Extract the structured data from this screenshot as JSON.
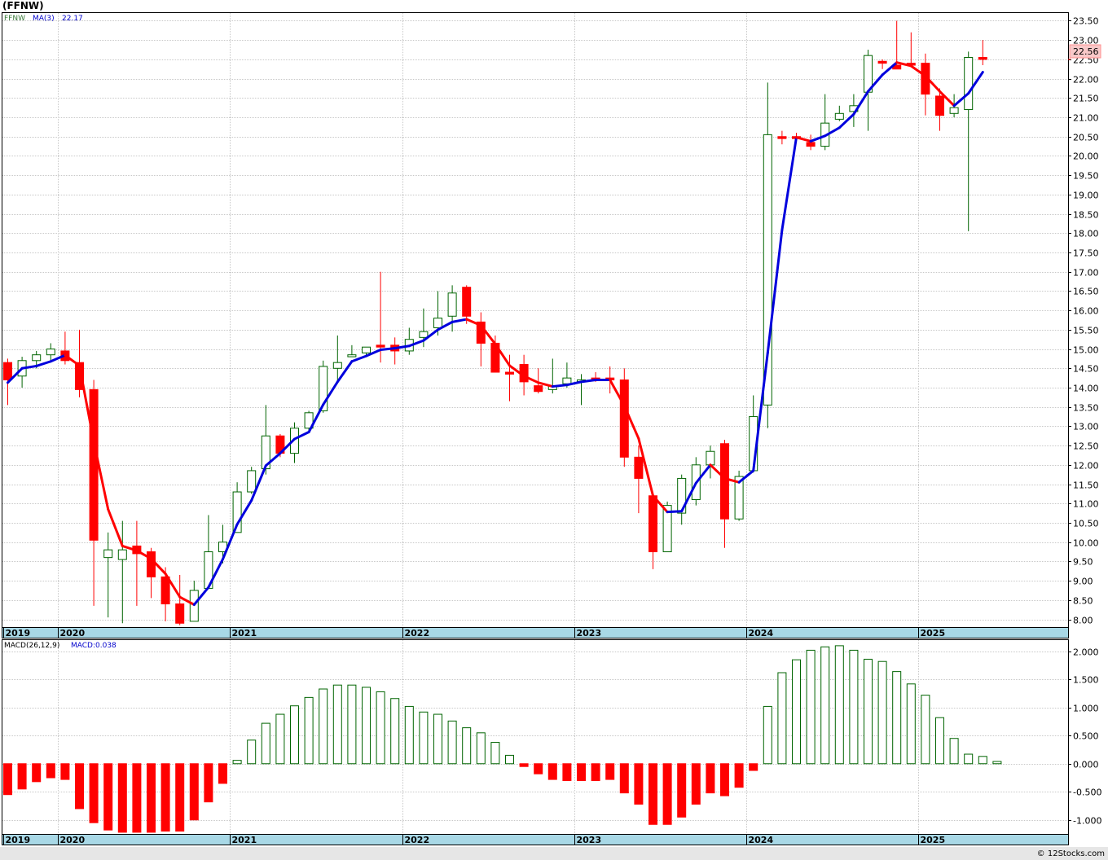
{
  "title": "(FFNW)",
  "footer": "© 12Stocks.com",
  "colors": {
    "up": "#006400",
    "down": "#ff0000",
    "ma_up": "#0000dd",
    "ma_down": "#ff0000",
    "axis_band": "#a8d8e6",
    "grid": "#c8c8c8"
  },
  "chart_data": [
    {
      "type": "candlestick",
      "ticker": "FFNW",
      "legend": {
        "symbol": "FFNW",
        "ma_label": "MA(3)",
        "ma_value": "22.17"
      },
      "last_price_label": "22.56",
      "ylim": [
        7.8,
        23.7
      ],
      "y_ticks": [
        "8.00",
        "8.50",
        "9.00",
        "9.50",
        "10.00",
        "10.50",
        "11.00",
        "11.50",
        "12.00",
        "12.50",
        "13.00",
        "13.50",
        "14.00",
        "14.50",
        "15.00",
        "15.50",
        "16.00",
        "16.50",
        "17.00",
        "17.50",
        "18.00",
        "18.50",
        "19.00",
        "19.50",
        "20.00",
        "20.50",
        "21.00",
        "21.50",
        "22.00",
        "22.50",
        "23.00",
        "23.50"
      ],
      "x_labels": [
        {
          "label": "2019",
          "i": -0.3
        },
        {
          "label": "2020",
          "i": 3.5
        },
        {
          "label": "2021",
          "i": 15.5
        },
        {
          "label": "2022",
          "i": 27.5
        },
        {
          "label": "2023",
          "i": 39.5
        },
        {
          "label": "2024",
          "i": 51.5
        },
        {
          "label": "2025",
          "i": 63.5
        }
      ],
      "ohlc": [
        [
          14.65,
          14.75,
          13.55,
          14.2
        ],
        [
          14.3,
          14.8,
          14.0,
          14.7
        ],
        [
          14.7,
          14.95,
          14.5,
          14.85
        ],
        [
          14.85,
          15.15,
          14.65,
          15.0
        ],
        [
          14.95,
          15.45,
          14.6,
          14.7
        ],
        [
          14.65,
          15.5,
          13.75,
          13.95
        ],
        [
          13.95,
          14.2,
          8.35,
          10.05
        ],
        [
          9.6,
          10.25,
          8.05,
          9.8
        ],
        [
          9.55,
          10.55,
          7.9,
          9.8
        ],
        [
          9.9,
          10.55,
          8.35,
          9.7
        ],
        [
          9.75,
          9.85,
          8.55,
          9.1
        ],
        [
          9.1,
          9.35,
          7.95,
          8.4
        ],
        [
          8.4,
          9.15,
          7.85,
          7.9
        ],
        [
          7.95,
          9.0,
          7.95,
          8.75
        ],
        [
          8.8,
          10.7,
          8.8,
          9.75
        ],
        [
          9.75,
          10.45,
          9.45,
          10.0
        ],
        [
          10.25,
          11.55,
          10.25,
          11.3
        ],
        [
          11.3,
          11.95,
          11.25,
          11.85
        ],
        [
          11.9,
          13.55,
          11.75,
          12.75
        ],
        [
          12.75,
          12.8,
          12.2,
          12.3
        ],
        [
          12.3,
          13.1,
          12.05,
          12.95
        ],
        [
          12.95,
          13.4,
          12.85,
          13.35
        ],
        [
          13.4,
          14.7,
          13.35,
          14.55
        ],
        [
          14.5,
          15.35,
          14.1,
          14.65
        ],
        [
          14.8,
          15.1,
          14.8,
          14.85
        ],
        [
          14.9,
          15.0,
          14.85,
          15.05
        ],
        [
          15.1,
          17.0,
          14.65,
          15.05
        ],
        [
          15.1,
          15.3,
          14.6,
          14.95
        ],
        [
          14.95,
          15.55,
          14.85,
          15.25
        ],
        [
          15.3,
          16.05,
          15.05,
          15.45
        ],
        [
          15.55,
          16.5,
          15.35,
          15.8
        ],
        [
          15.85,
          16.65,
          15.45,
          16.45
        ],
        [
          16.6,
          16.65,
          15.65,
          15.85
        ],
        [
          15.7,
          15.95,
          14.55,
          15.15
        ],
        [
          15.15,
          15.35,
          14.65,
          14.4
        ],
        [
          14.4,
          14.85,
          13.65,
          14.35
        ],
        [
          14.6,
          14.85,
          13.8,
          14.15
        ],
        [
          14.05,
          14.5,
          13.85,
          13.9
        ],
        [
          13.95,
          14.75,
          13.85,
          14.05
        ],
        [
          14.1,
          14.65,
          14.0,
          14.25
        ],
        [
          14.2,
          14.35,
          13.55,
          14.2
        ],
        [
          14.25,
          14.4,
          14.15,
          14.2
        ],
        [
          14.25,
          14.55,
          13.85,
          14.2
        ],
        [
          14.2,
          14.5,
          11.95,
          12.2
        ],
        [
          12.2,
          12.5,
          10.75,
          11.65
        ],
        [
          11.2,
          11.3,
          9.3,
          9.75
        ],
        [
          9.75,
          11.05,
          9.75,
          10.95
        ],
        [
          10.75,
          11.75,
          10.45,
          11.65
        ],
        [
          11.1,
          12.2,
          10.95,
          12.0
        ],
        [
          12.0,
          12.5,
          11.65,
          12.35
        ],
        [
          12.55,
          12.65,
          9.85,
          10.6
        ],
        [
          10.6,
          11.85,
          10.55,
          11.7
        ],
        [
          11.85,
          13.8,
          11.8,
          13.25
        ],
        [
          13.55,
          21.9,
          12.95,
          20.55
        ],
        [
          20.5,
          20.65,
          20.3,
          20.45
        ],
        [
          20.5,
          20.6,
          20.45,
          20.45
        ],
        [
          20.35,
          20.55,
          20.15,
          20.25
        ],
        [
          20.25,
          21.6,
          20.15,
          20.85
        ],
        [
          20.95,
          21.3,
          20.9,
          21.1
        ],
        [
          21.15,
          21.6,
          20.75,
          21.3
        ],
        [
          21.65,
          22.75,
          20.65,
          22.6
        ],
        [
          22.45,
          22.5,
          22.25,
          22.4
        ],
        [
          22.35,
          23.5,
          22.25,
          22.25
        ],
        [
          22.4,
          23.2,
          22.35,
          22.35
        ],
        [
          22.4,
          22.65,
          21.05,
          21.6
        ],
        [
          21.55,
          21.75,
          20.65,
          21.05
        ],
        [
          21.1,
          21.6,
          21.0,
          21.25
        ],
        [
          21.2,
          22.7,
          18.05,
          22.55
        ],
        [
          22.55,
          23.0,
          22.35,
          22.5
        ]
      ],
      "ma3": [
        14.13,
        14.5,
        14.56,
        14.68,
        14.84,
        14.57,
        12.6,
        10.85,
        9.9,
        9.78,
        9.57,
        9.18,
        8.58,
        8.38,
        8.83,
        9.56,
        10.46,
        11.08,
        11.98,
        12.3,
        12.67,
        12.85,
        13.56,
        14.15,
        14.68,
        14.82,
        14.98,
        15.02,
        15.08,
        15.22,
        15.5,
        15.7,
        15.77,
        15.61,
        15.13,
        14.57,
        14.3,
        14.13,
        14.03,
        14.07,
        14.15,
        14.2,
        14.2,
        13.53,
        12.68,
        11.2,
        10.78,
        10.8,
        11.53,
        12.0,
        11.65,
        11.55,
        11.85,
        14.9,
        18.08,
        20.48,
        20.38,
        20.52,
        20.73,
        21.08,
        21.67,
        22.1,
        22.42,
        22.33,
        22.07,
        21.67,
        21.3,
        21.62,
        22.17
      ]
    },
    {
      "type": "bar",
      "legend": {
        "label": "MACD(26,12,9)",
        "value_label": "MACD:0.038"
      },
      "ylim": [
        -1.25,
        2.2
      ],
      "y_ticks": [
        "-1.000",
        "-0.500",
        "0.000",
        "0.500",
        "1.000",
        "1.500",
        "2.000"
      ],
      "values": [
        -0.55,
        -0.45,
        -0.32,
        -0.25,
        -0.28,
        -0.8,
        -1.05,
        -1.18,
        -1.22,
        -1.22,
        -1.22,
        -1.2,
        -1.2,
        -1.0,
        -0.68,
        -0.35,
        0.06,
        0.42,
        0.72,
        0.88,
        1.03,
        1.18,
        1.33,
        1.4,
        1.4,
        1.36,
        1.28,
        1.16,
        1.02,
        0.92,
        0.88,
        0.76,
        0.64,
        0.55,
        0.38,
        0.15,
        -0.05,
        -0.18,
        -0.28,
        -0.3,
        -0.3,
        -0.3,
        -0.28,
        -0.52,
        -0.72,
        -1.08,
        -1.08,
        -0.95,
        -0.72,
        -0.52,
        -0.57,
        -0.42,
        -0.12,
        1.02,
        1.62,
        1.85,
        2.02,
        2.08,
        2.1,
        2.02,
        1.86,
        1.82,
        1.64,
        1.42,
        1.22,
        0.82,
        0.45,
        0.17,
        0.13,
        0.04
      ]
    }
  ]
}
